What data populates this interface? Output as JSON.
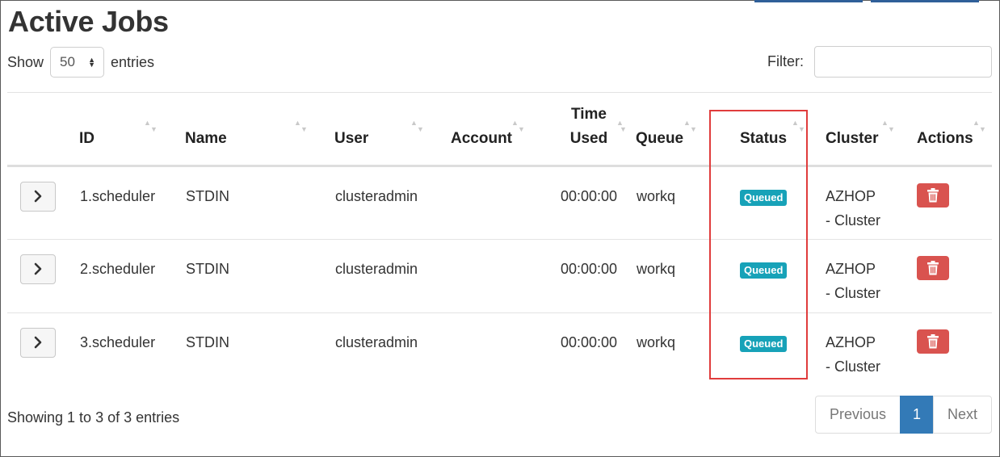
{
  "title": "Active Jobs",
  "length_menu": {
    "prefix": "Show",
    "value": "50",
    "suffix": "entries"
  },
  "filter": {
    "label": "Filter:",
    "value": ""
  },
  "columns": [
    "",
    "ID",
    "Name",
    "User",
    "Account",
    "Time Used",
    "Queue",
    "Status",
    "Cluster",
    "Actions"
  ],
  "rows": [
    {
      "id": "1.scheduler",
      "name": "STDIN",
      "user": "clusteradmin",
      "account": "",
      "time_used": "00:00:00",
      "queue": "workq",
      "status": "Queued",
      "cluster": "AZHOP - Cluster"
    },
    {
      "id": "2.scheduler",
      "name": "STDIN",
      "user": "clusteradmin",
      "account": "",
      "time_used": "00:00:00",
      "queue": "workq",
      "status": "Queued",
      "cluster": "AZHOP - Cluster"
    },
    {
      "id": "3.scheduler",
      "name": "STDIN",
      "user": "clusteradmin",
      "account": "",
      "time_used": "00:00:00",
      "queue": "workq",
      "status": "Queued",
      "cluster": "AZHOP - Cluster"
    }
  ],
  "info": "Showing 1 to 3 of 3 entries",
  "pagination": {
    "previous": "Previous",
    "current": "1",
    "next": "Next"
  },
  "colors": {
    "badge": "#17a2b8",
    "delete": "#d9534f",
    "active_page": "#337ab7",
    "highlight": "#e03c3c"
  },
  "icons": {
    "expand": "chevron-right-icon",
    "delete": "trash-icon",
    "sort": "sort-icon"
  }
}
